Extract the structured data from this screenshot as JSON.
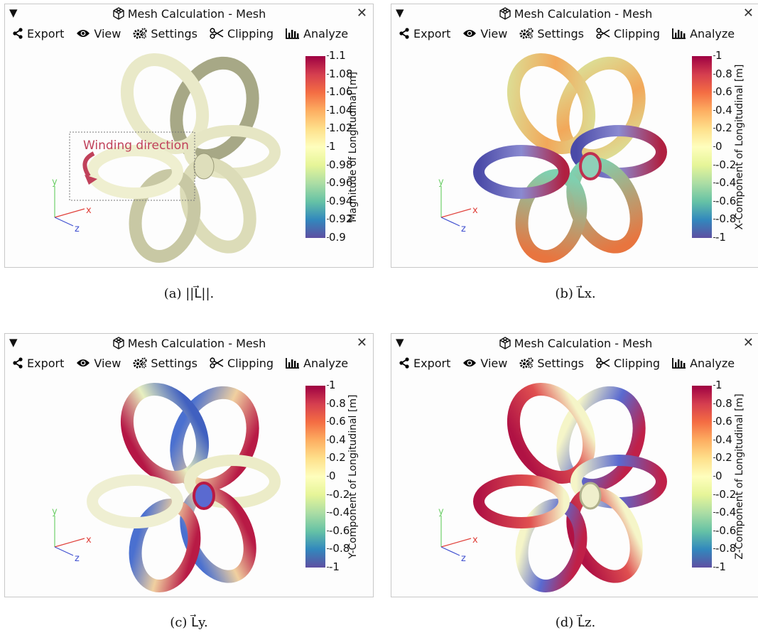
{
  "window": {
    "title": "Mesh Calculation - Mesh",
    "collapse_glyph": "▼",
    "close_glyph": "✕"
  },
  "toolbar": [
    {
      "label": "Export",
      "icon": "share-icon"
    },
    {
      "label": "View",
      "icon": "eye-icon"
    },
    {
      "label": "Settings",
      "icon": "gears-icon"
    },
    {
      "label": "Clipping",
      "icon": "scissors-icon"
    },
    {
      "label": "Analyze",
      "icon": "bar-chart-icon"
    }
  ],
  "axes": {
    "x": "x",
    "y": "y",
    "z": "z"
  },
  "panels": {
    "a": {
      "caption": "(a) ||L⃗||.",
      "colorbar_title": "Magnitude of Longitudinal [m]",
      "ticks": [
        "1.1",
        "1.08",
        "1.06",
        "1.04",
        "1.02",
        "1",
        "0.98",
        "0.96",
        "0.94",
        "0.92",
        "0.9"
      ],
      "annotation": "Winding direction"
    },
    "b": {
      "caption": "(b) L⃗x.",
      "colorbar_title": "X-Component of Longitudinal [m]",
      "ticks": [
        "1",
        "0.8",
        "0.6",
        "0.4",
        "0.2",
        "0",
        "-0.2",
        "-0.4",
        "-0.6",
        "-0.8",
        "-1"
      ]
    },
    "c": {
      "caption": "(c) L⃗y.",
      "colorbar_title": "Y-Component of Longitudinal [m]",
      "ticks": [
        "1",
        "0.8",
        "0.6",
        "0.4",
        "0.2",
        "0",
        "-0.2",
        "-0.4",
        "-0.6",
        "-0.8",
        "-1"
      ]
    },
    "d": {
      "caption": "(d) L⃗z.",
      "colorbar_title": "Z-Component of Longitudinal [m]",
      "ticks": [
        "1",
        "0.8",
        "0.6",
        "0.4",
        "0.2",
        "0",
        "-0.2",
        "-0.4",
        "-0.6",
        "-0.8",
        "-1"
      ]
    }
  },
  "colors": {
    "cmap_top": "#9e0142",
    "cmap_mid": "#fefebd",
    "cmap_bottom": "#5e4fa2",
    "annotation": "#c0415a",
    "axis_x": "#e0403a",
    "axis_y": "#6fcf6a",
    "axis_z": "#4050d0"
  }
}
